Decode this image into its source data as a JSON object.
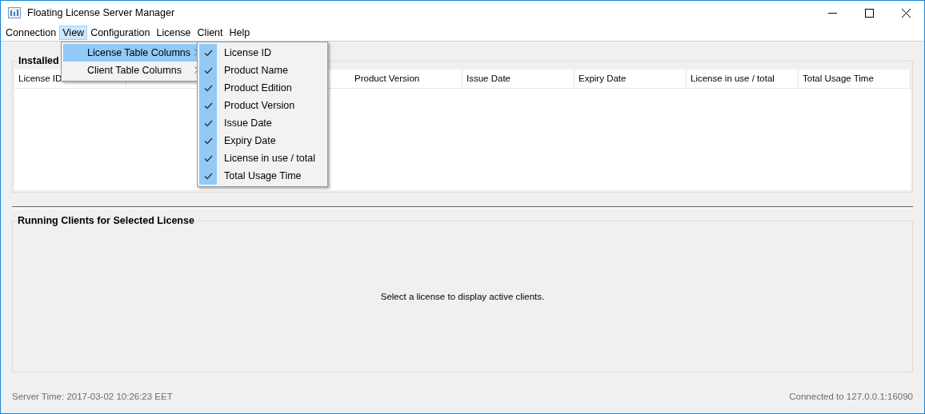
{
  "window": {
    "title": "Floating License Server Manager"
  },
  "menubar": [
    {
      "label": "Connection",
      "selected": false
    },
    {
      "label": "View",
      "selected": true
    },
    {
      "label": "Configuration",
      "selected": false
    },
    {
      "label": "License",
      "selected": false
    },
    {
      "label": "Client",
      "selected": false
    },
    {
      "label": "Help",
      "selected": false
    }
  ],
  "view_menu": [
    {
      "label": "License Table Columns",
      "selected": true
    },
    {
      "label": "Client Table Columns",
      "selected": false
    }
  ],
  "columns_submenu": [
    {
      "label": "License ID",
      "checked": true
    },
    {
      "label": "Product Name",
      "checked": true
    },
    {
      "label": "Product Edition",
      "checked": true
    },
    {
      "label": "Product Version",
      "checked": true
    },
    {
      "label": "Issue Date",
      "checked": true
    },
    {
      "label": "Expiry Date",
      "checked": true
    },
    {
      "label": "License in use / total",
      "checked": true
    },
    {
      "label": "Total Usage Time",
      "checked": true
    }
  ],
  "installed_panel": {
    "title": "Installed",
    "columns": [
      "License ID",
      "Product Version",
      "Issue Date",
      "Expiry Date",
      "License in use / total",
      "Total Usage Time"
    ]
  },
  "clients_panel": {
    "title": "Running Clients for Selected License",
    "message": "Select a license to display active clients."
  },
  "status_bar": {
    "server_time": "Server Time: 2017-03-02 10:26:23 EET",
    "connection": "Connected to 127.0.0.1:16090"
  }
}
